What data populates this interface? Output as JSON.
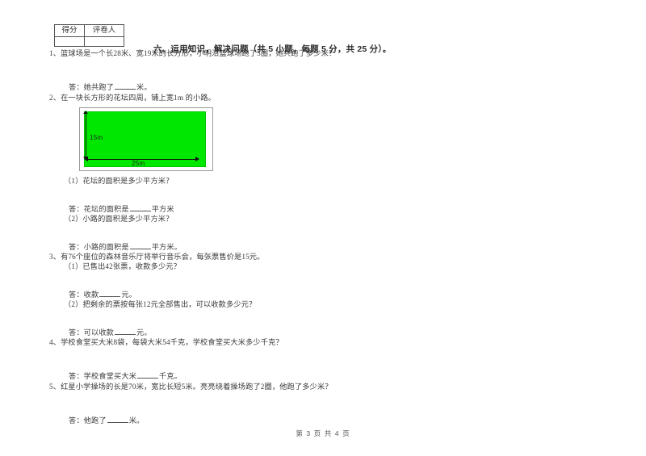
{
  "document": {
    "score_table": {
      "header_score": "得分",
      "header_grader": "评卷人",
      "score_value": "",
      "grader_value": ""
    },
    "section_title": "六、运用知识，解决问题（共 5 小题，每题 5 分，共 25 分）。",
    "questions": [
      {
        "number": "1、",
        "text": "篮球场是一个长28米、宽19米的长方形，小明沿篮球场跑了3圈，她共跑了多少米？",
        "answer_prefix": "答：她共跑了",
        "answer_suffix": "米。"
      },
      {
        "number": "2、",
        "text": "在一块长方形的花坛四周，铺上宽1m 的小路。",
        "sub1": "（1）花坛的面积是多少平方米？",
        "sub1_answer_prefix": "答：花坛的面积是",
        "sub1_answer_suffix": "平方米",
        "sub2": "（2）小路的面积是多少平方米？",
        "sub2_answer_prefix": "答：小路的面积是",
        "sub2_answer_suffix": "平方米。"
      },
      {
        "number": "3、",
        "text": "有76个座位的森林音乐厅将举行音乐会，每张票售价是15元。",
        "sub1": "（1）已售出42张票，收款多少元？",
        "sub1_answer_prefix": "答：收款",
        "sub1_answer_suffix": "元。",
        "sub2": "（2）把剩余的票按每张12元全部售出，可以收款多少元？",
        "sub2_answer_prefix": "答：可以收款",
        "sub2_answer_suffix": "元。"
      },
      {
        "number": "4、",
        "text": "学校食堂买大米8袋，每袋大米54千克，学校食堂买大米多少千克？",
        "answer_prefix": "答：学校食堂买大米",
        "answer_suffix": "千克。"
      },
      {
        "number": "5、",
        "text": "红星小学操场的长是70米，宽比长短5米。亮亮绕着操场跑了2圈，他跑了多少米？",
        "answer_prefix": "答：他跑了",
        "answer_suffix": "米。"
      }
    ],
    "figure": {
      "width_label": "25m",
      "height_label": "15m",
      "fill_color": "#00e800"
    },
    "footer": "第 3 页 共 4 页"
  }
}
